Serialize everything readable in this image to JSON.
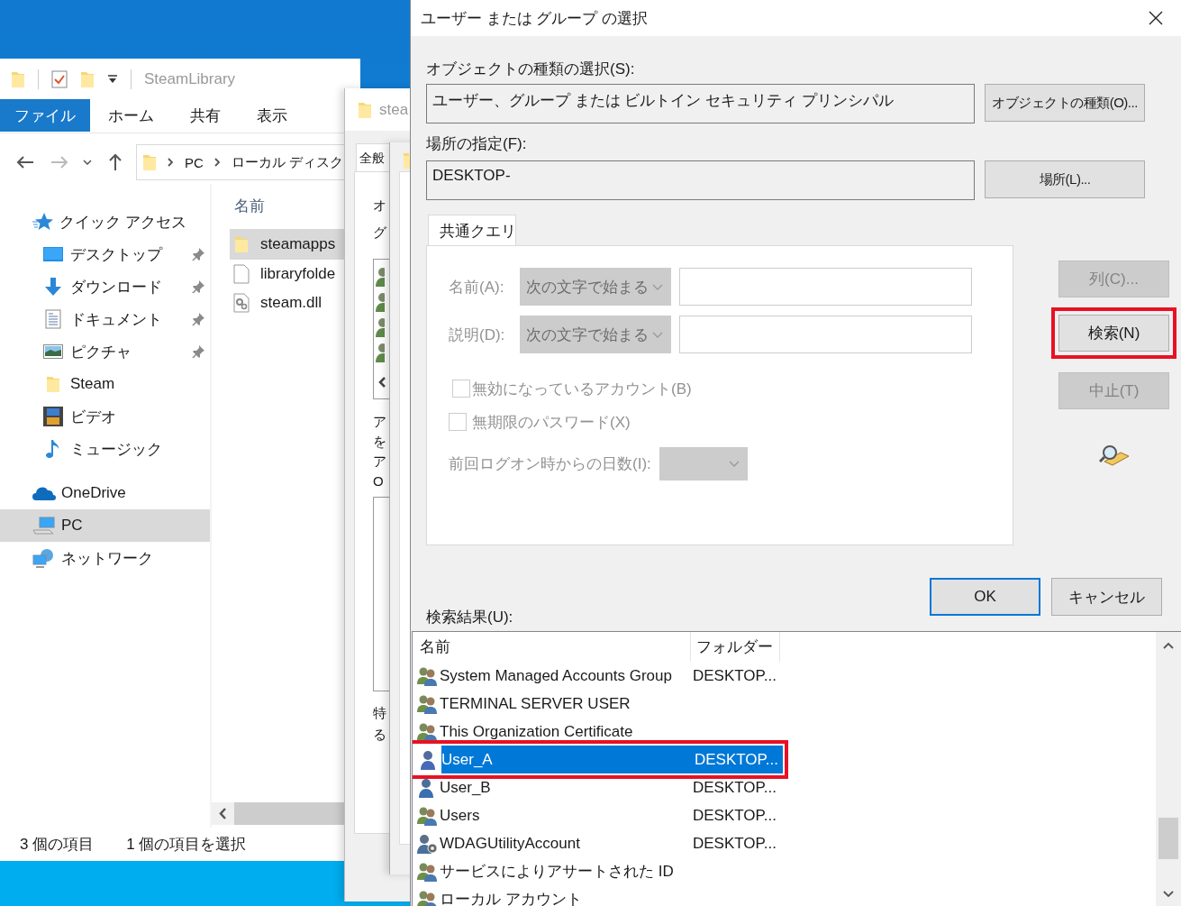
{
  "explorer": {
    "title": "SteamLibrary",
    "ribbon_tabs": [
      {
        "label": "ファイル",
        "selected": true
      },
      {
        "label": "ホーム",
        "selected": false
      },
      {
        "label": "共有",
        "selected": false
      },
      {
        "label": "表示",
        "selected": false
      }
    ],
    "breadcrumb": [
      "PC",
      "ローカル ディスク"
    ],
    "nav": [
      {
        "label": "クイック アクセス",
        "selected": false,
        "pinned": false,
        "children": [
          {
            "label": "デスクトップ",
            "selected": false,
            "pinned": true
          },
          {
            "label": "ダウンロード",
            "selected": false,
            "pinned": true
          },
          {
            "label": "ドキュメント",
            "selected": false,
            "pinned": true
          },
          {
            "label": "ピクチャ",
            "selected": false,
            "pinned": true
          },
          {
            "label": "Steam",
            "selected": false,
            "pinned": false
          },
          {
            "label": "ビデオ",
            "selected": false,
            "pinned": false
          },
          {
            "label": "ミュージック",
            "selected": false,
            "pinned": false
          }
        ]
      },
      {
        "label": "OneDrive",
        "selected": false,
        "pinned": false
      },
      {
        "label": "PC",
        "selected": true,
        "pinned": false
      },
      {
        "label": "ネットワーク",
        "selected": false,
        "pinned": false
      }
    ],
    "column": "名前",
    "files": [
      {
        "name": "steamapps",
        "kind": "folder",
        "selected": true
      },
      {
        "name": "libraryfolde",
        "kind": "file",
        "selected": false
      },
      {
        "name": "steam.dll",
        "kind": "dll",
        "selected": false
      }
    ],
    "status_bar": [
      "3 個の項目",
      "1 個の項目を選択"
    ]
  },
  "properties_dialog": {
    "title": "stea",
    "tab": "全般",
    "texts_top": [
      "オ",
      "グ"
    ],
    "texts_middle": [
      "ア",
      "を",
      "ア",
      "O"
    ],
    "texts_bottom": [
      "特",
      "る"
    ]
  },
  "select_dialog": {
    "title": "ユーザー または グループ の選択",
    "object_type": {
      "label": "オブジェクトの種類の選択(S):",
      "value": "ユーザー、グループ または ビルトイン セキュリティ プリンシパル",
      "button": "オブジェクトの種類(O)..."
    },
    "location": {
      "label": "場所の指定(F):",
      "value": "DESKTOP-",
      "button": "場所(L)..."
    },
    "query_tab": {
      "label": "共通クエリ",
      "selected": true
    },
    "query": {
      "disabled": true,
      "name": {
        "label": "名前(A):",
        "condition": "次の文字で始まる"
      },
      "description": {
        "label": "説明(D):",
        "condition": "次の文字で始まる"
      },
      "checkboxes": [
        {
          "label": "無効になっているアカウント(B)",
          "checked": false
        },
        {
          "label": "無期限のパスワード(X)",
          "checked": false
        }
      ],
      "days_label": "前回ログオン時からの日数(I):"
    },
    "side_buttons": [
      {
        "label": "列(C)...",
        "disabled": true,
        "annotated": false
      },
      {
        "label": "検索(N)",
        "disabled": false,
        "annotated": true
      },
      {
        "label": "中止(T)",
        "disabled": true,
        "annotated": false
      }
    ],
    "ok": "OK",
    "cancel": "キャンセル",
    "results": {
      "label": "検索結果(U):",
      "columns": [
        "名前",
        "フォルダー"
      ],
      "rows": [
        {
          "name": "System Managed Accounts Group",
          "folder": "DESKTOP...",
          "kind": "group",
          "selected": false,
          "annotated": false
        },
        {
          "name": "TERMINAL SERVER USER",
          "kind": "group",
          "selected": false,
          "annotated": false
        },
        {
          "name": "This Organization Certificate",
          "kind": "group",
          "selected": false,
          "annotated": false
        },
        {
          "name": "User_A",
          "folder": "DESKTOP...",
          "kind": "user",
          "selected": true,
          "annotated": true
        },
        {
          "name": "User_B",
          "folder": "DESKTOP...",
          "kind": "user",
          "selected": false,
          "annotated": false
        },
        {
          "name": "Users",
          "folder": "DESKTOP...",
          "kind": "group",
          "selected": false,
          "annotated": false
        },
        {
          "name": "WDAGUtilityAccount",
          "folder": "DESKTOP...",
          "kind": "service",
          "selected": false,
          "annotated": false
        },
        {
          "name": "サービスによりアサートされた ID",
          "kind": "group",
          "selected": false,
          "annotated": false
        },
        {
          "name": "ローカル アカウント",
          "kind": "group",
          "selected": false,
          "annotated": false
        }
      ]
    }
  }
}
